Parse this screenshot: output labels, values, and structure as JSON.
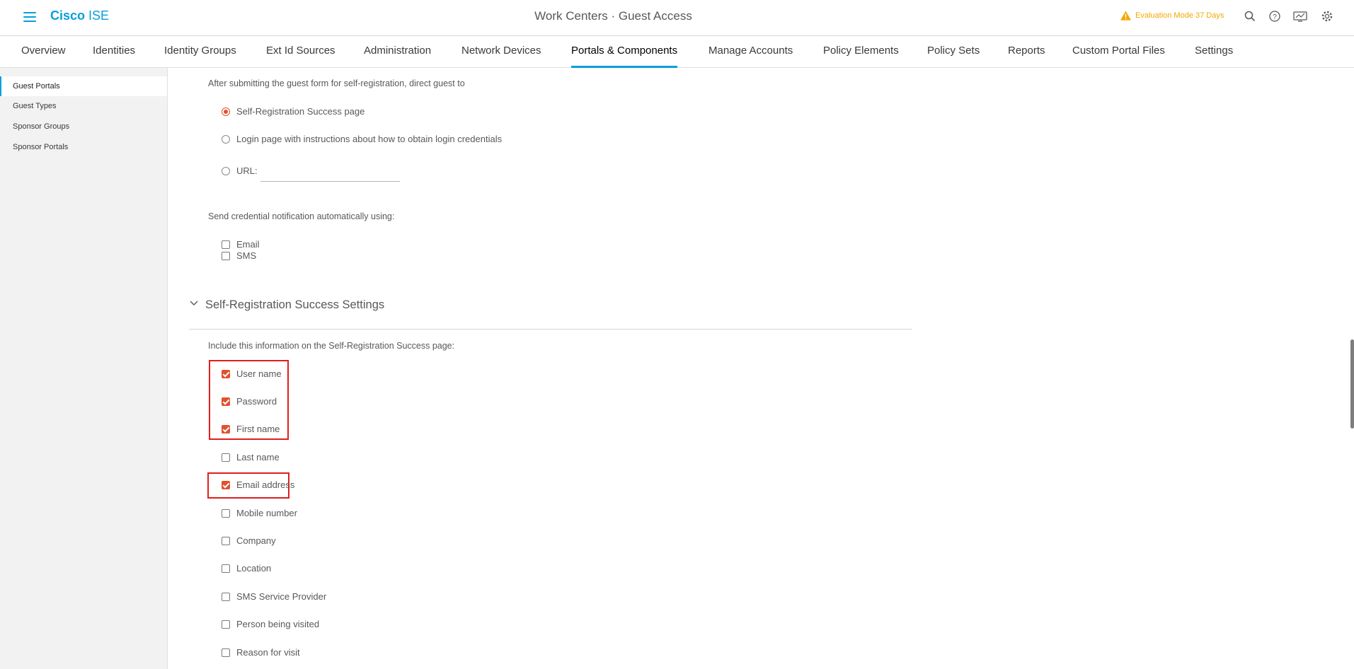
{
  "header": {
    "brand_bold": "Cisco",
    "brand_light": "ISE",
    "title": "Work Centers · Guest Access",
    "eval_text": "Evaluation Mode 37 Days"
  },
  "nav_tabs": [
    {
      "label": "Overview"
    },
    {
      "label": "Identities"
    },
    {
      "label": "Identity Groups"
    },
    {
      "label": "Ext Id Sources"
    },
    {
      "label": "Administration"
    },
    {
      "label": "Network Devices"
    },
    {
      "label": "Portals & Components",
      "active": true
    },
    {
      "label": "Manage Accounts"
    },
    {
      "label": "Policy Elements"
    },
    {
      "label": "Policy Sets"
    },
    {
      "label": "Reports"
    },
    {
      "label": "Custom Portal Files"
    },
    {
      "label": "Settings"
    }
  ],
  "sidebar": {
    "items": [
      {
        "label": "Guest Portals",
        "active": true
      },
      {
        "label": "Guest Types"
      },
      {
        "label": "Sponsor Groups"
      },
      {
        "label": "Sponsor Portals"
      }
    ]
  },
  "redirect": {
    "intro": "After submitting the guest form for self-registration, direct guest to",
    "options": [
      {
        "label": "Self-Registration Success page",
        "selected": true
      },
      {
        "label": "Login page with instructions about how to obtain login credentials",
        "selected": false
      },
      {
        "label": "URL:",
        "selected": false
      }
    ],
    "url_value": ""
  },
  "notification": {
    "intro": "Send credential notification automatically using:",
    "options": [
      {
        "label": "Email",
        "checked": false
      },
      {
        "label": "SMS",
        "checked": false
      }
    ]
  },
  "success_settings": {
    "title": "Self-Registration Success Settings",
    "intro": "Include this information on the Self-Registration Success page:",
    "fields": [
      {
        "label": "User name",
        "checked": true
      },
      {
        "label": "Password",
        "checked": true
      },
      {
        "label": "First name",
        "checked": true
      },
      {
        "label": "Last name",
        "checked": false
      },
      {
        "label": "Email address",
        "checked": true
      },
      {
        "label": "Mobile number",
        "checked": false
      },
      {
        "label": "Company",
        "checked": false
      },
      {
        "label": "Location",
        "checked": false
      },
      {
        "label": "SMS Service Provider",
        "checked": false
      },
      {
        "label": "Person being visited",
        "checked": false
      },
      {
        "label": "Reason for visit",
        "checked": false
      }
    ]
  },
  "colors": {
    "accent": "#049fd9",
    "checked": "#e2512d",
    "highlight": "#e01e1e",
    "warning": "#f2a800"
  }
}
